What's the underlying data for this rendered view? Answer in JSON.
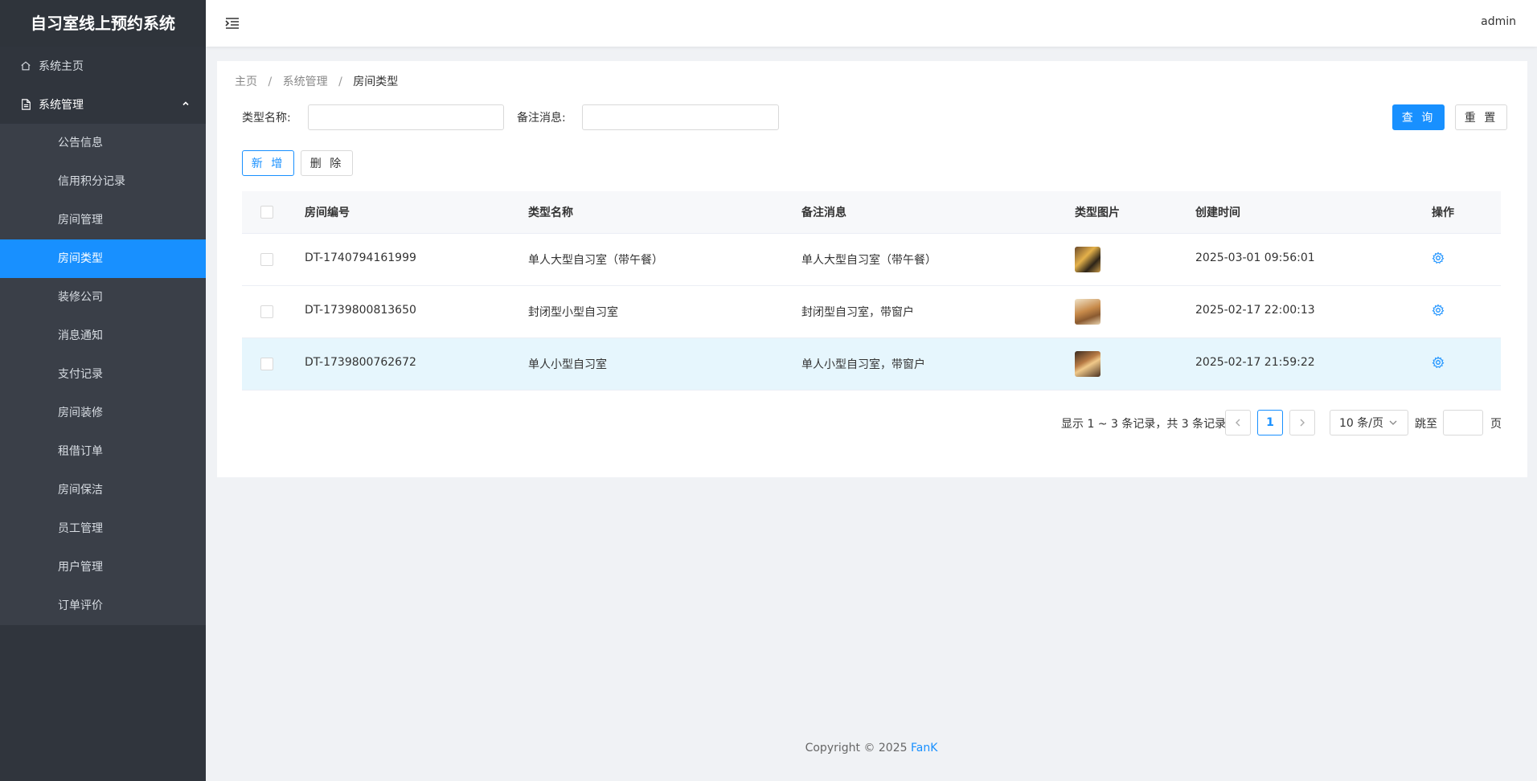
{
  "app": {
    "title": "自习室线上预约系统"
  },
  "sidebar": {
    "home_label": "系统主页",
    "group_label": "系统管理",
    "items": [
      {
        "label": "公告信息"
      },
      {
        "label": "信用积分记录"
      },
      {
        "label": "房间管理"
      },
      {
        "label": "房间类型",
        "active": true
      },
      {
        "label": "装修公司"
      },
      {
        "label": "消息通知"
      },
      {
        "label": "支付记录"
      },
      {
        "label": "房间装修"
      },
      {
        "label": "租借订单"
      },
      {
        "label": "房间保洁"
      },
      {
        "label": "员工管理"
      },
      {
        "label": "用户管理"
      },
      {
        "label": "订单评价"
      }
    ]
  },
  "header": {
    "user": "admin"
  },
  "breadcrumb": {
    "home": "主页",
    "sep1": "/",
    "level1": "系统管理",
    "sep2": "/",
    "current": "房间类型"
  },
  "filters": {
    "type_name_label": "类型名称:",
    "type_name_value": "",
    "remark_label": "备注消息:",
    "remark_value": "",
    "search_label": "查 询",
    "reset_label": "重 置"
  },
  "toolbar": {
    "add_label": "新 增",
    "delete_label": "删 除"
  },
  "table": {
    "columns": [
      "房间编号",
      "类型名称",
      "备注消息",
      "类型图片",
      "创建时间",
      "操作"
    ],
    "rows": [
      {
        "id": "DT-1740794161999",
        "name": "单人大型自习室（带午餐）",
        "remark": "单人大型自习室（带午餐）",
        "created": "2025-03-01 09:56:01"
      },
      {
        "id": "DT-1739800813650",
        "name": "封闭型小型自习室",
        "remark": "封闭型自习室，带窗户",
        "created": "2025-02-17 22:00:13"
      },
      {
        "id": "DT-1739800762672",
        "name": "单人小型自习室",
        "remark": "单人小型自习室，带窗户",
        "created": "2025-02-17 21:59:22"
      }
    ]
  },
  "pagination": {
    "summary": "显示 1 ~ 3 条记录，共 3 条记录",
    "current_page": "1",
    "page_size": "10 条/页",
    "jump_label": "跳至",
    "page_unit": "页"
  },
  "footer": {
    "text": "Copyright © 2025 ",
    "author": "FanK"
  },
  "colors": {
    "accent": "#1890ff",
    "sidebar_bg": "#30353d",
    "submenu_bg": "#3a3f48",
    "row_highlight": "#e6f6fd"
  },
  "icons": {
    "home": "home-icon",
    "doc": "document-icon",
    "chevron": "chevron-up-icon",
    "menu": "menu-fold-icon",
    "gear": "gear-icon",
    "prev": "chevron-left-icon",
    "next": "chevron-right-icon",
    "dropdown": "chevron-down-icon"
  }
}
